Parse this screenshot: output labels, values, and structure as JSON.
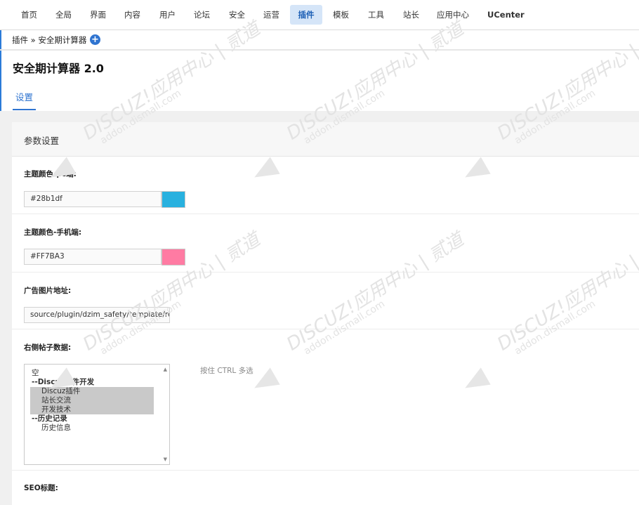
{
  "nav": {
    "items": [
      "首页",
      "全局",
      "界面",
      "内容",
      "用户",
      "论坛",
      "安全",
      "运营",
      "插件",
      "模板",
      "工具",
      "站长",
      "应用中心",
      "UCenter"
    ],
    "active": "插件"
  },
  "breadcrumb": {
    "text": "插件 » 安全期计算器"
  },
  "page": {
    "title": "安全期计算器 2.0",
    "tab": "设置"
  },
  "panel": {
    "header": "参数设置",
    "fields": {
      "pc_color": {
        "label": "主题颜色-pc端:",
        "value": "#28b1df",
        "swatch": "#28b1df"
      },
      "mobile_color": {
        "label": "主题颜色-手机端:",
        "value": "#FF7BA3",
        "swatch": "#FF7BA3"
      },
      "ad_image": {
        "label": "广告图片地址:",
        "value": "source/plugin/dzim_safety/template/res/ad.p"
      },
      "sidebar_posts": {
        "label": "右侧帖子数据:",
        "hint": "按住 CTRL 多选",
        "options": [
          "空",
          "--Discuz插件开发",
          "Discuz插件",
          "站长交流",
          "开发技术",
          "--历史记录",
          "历史信息"
        ]
      },
      "seo_title": {
        "label": "SEO标题:"
      }
    }
  },
  "watermark": {
    "brand": "DISCUZ!应用中心 | 贰道",
    "site": "addon.dismall.com"
  },
  "colors": {
    "accent": "#2f74d0",
    "active_bg": "#d5e5f8"
  }
}
